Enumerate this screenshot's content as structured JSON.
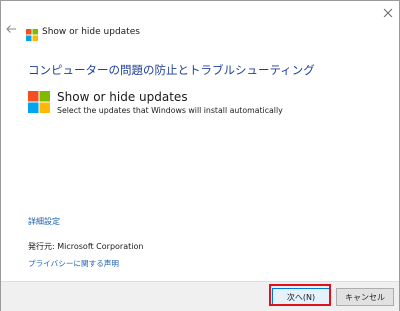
{
  "window": {
    "title": "Show or hide updates",
    "icons": {
      "back": "back-arrow-icon",
      "close": "close-icon",
      "logo": "windows-logo-icon"
    }
  },
  "main": {
    "heading": "コンピューターの問題の防止とトラブルシューティング",
    "app_name": "Show or hide updates",
    "app_description": "Select the updates that Windows will install automatically",
    "advanced_link": "詳細設定",
    "publisher": "発行元:  Microsoft Corporation",
    "privacy_link": "プライバシーに関する声明"
  },
  "footer": {
    "next_label": "次へ(N)",
    "cancel_label": "キャンセル"
  },
  "colors": {
    "heading": "#1f3f9a",
    "link": "#1a5fb4",
    "highlight": "#e0111a",
    "logo_red": "#f25022",
    "logo_green": "#7fba00",
    "logo_blue": "#00a4ef",
    "logo_yellow": "#ffb900"
  }
}
